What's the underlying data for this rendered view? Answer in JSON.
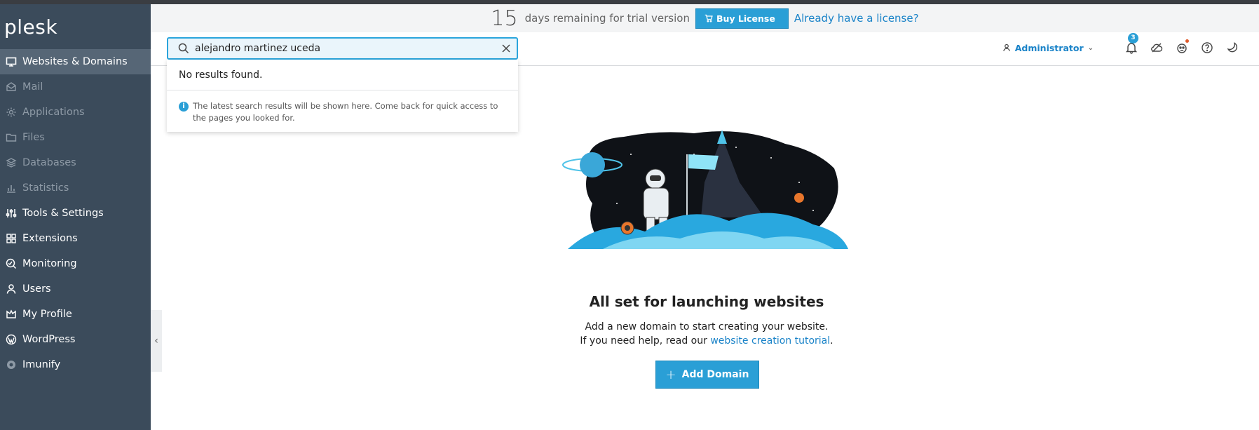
{
  "app": {
    "logo_text": "plesk"
  },
  "sidebar": {
    "items": [
      {
        "label": "Websites & Domains",
        "icon": "monitor-icon"
      },
      {
        "label": "Mail",
        "icon": "mail-icon"
      },
      {
        "label": "Applications",
        "icon": "gear-icon"
      },
      {
        "label": "Files",
        "icon": "folder-icon"
      },
      {
        "label": "Databases",
        "icon": "layers-icon"
      },
      {
        "label": "Statistics",
        "icon": "bar-chart-icon"
      },
      {
        "label": "Tools & Settings",
        "icon": "sliders-icon"
      },
      {
        "label": "Extensions",
        "icon": "grid-icon"
      },
      {
        "label": "Monitoring",
        "icon": "monitoring-icon"
      },
      {
        "label": "Users",
        "icon": "user-icon"
      },
      {
        "label": "My Profile",
        "icon": "profile-icon"
      },
      {
        "label": "WordPress",
        "icon": "wordpress-icon"
      },
      {
        "label": "Imunify",
        "icon": "shield-gear-icon"
      }
    ],
    "collapse_glyph": "‹"
  },
  "trial": {
    "days": "15",
    "text": "days remaining for trial version",
    "buy_label": "Buy License",
    "license_link": "Already have a license?"
  },
  "search": {
    "value": "alejandro martinez uceda",
    "no_results": "No results found.",
    "info_text": "The latest search results will be shown here. Come back for quick access to the pages you looked for."
  },
  "header": {
    "user_label": "Administrator",
    "notifications_count": "3"
  },
  "main": {
    "title": "All set for launching websites",
    "desc_line1": "Add a new domain to start creating your website.",
    "desc_line2_prefix": "If you need help, read our ",
    "desc_link": "website creation tutorial",
    "desc_line2_suffix": ".",
    "add_domain_label": "Add Domain"
  },
  "colors": {
    "sidebar_bg": "#3b4b5b",
    "sidebar_active": "#566676",
    "accent": "#2a9fd6",
    "link": "#1a83c8"
  }
}
